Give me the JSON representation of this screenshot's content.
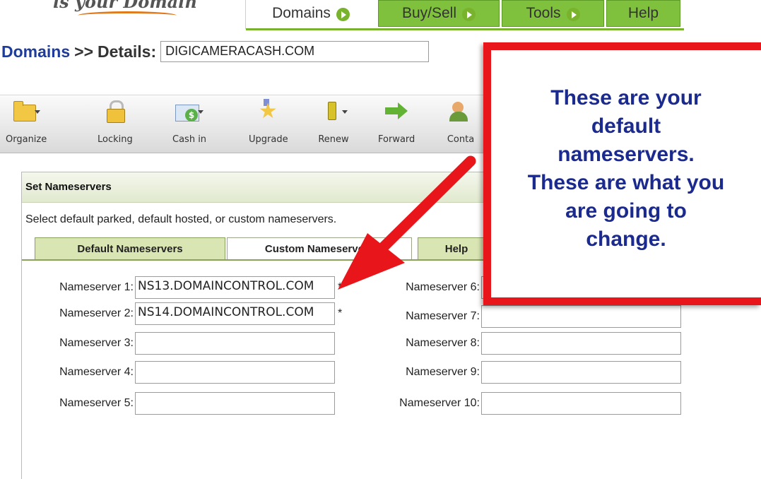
{
  "nav": {
    "logo_text": "ls your Domain",
    "tabs": [
      {
        "label": "Domains"
      },
      {
        "label": "Buy/Sell"
      },
      {
        "label": "Tools"
      },
      {
        "label": "Help"
      }
    ],
    "colors": {
      "active_tab_bg": "#ffffff",
      "tab_bg": "#7fc13c",
      "tab_icon": "#79b32d"
    }
  },
  "breadcrumb": {
    "root": "Domains",
    "separator": ">>",
    "page": "Details:",
    "domain_value": "DIGICAMERACASH.COM"
  },
  "toolbar": {
    "items": [
      {
        "label": "Organize",
        "icon": "folder-icon"
      },
      {
        "label": "Locking",
        "icon": "lock-icon"
      },
      {
        "label": "Cash in",
        "icon": "cash-icon"
      },
      {
        "label": "Upgrade",
        "icon": "star-icon"
      },
      {
        "label": "Renew",
        "icon": "renew-icon"
      },
      {
        "label": "Forward",
        "icon": "forward-arrow-icon"
      },
      {
        "label": "Conta",
        "icon": "contact-icon"
      }
    ]
  },
  "nameservers": {
    "title": "Set Nameservers",
    "description": "Select default parked, default hosted, or custom nameservers.",
    "tabs": [
      {
        "label": "Default Nameservers"
      },
      {
        "label": "Custom Nameservers"
      },
      {
        "label": "Help"
      }
    ],
    "fields": [
      {
        "label": "Nameserver 1:",
        "value": "NS13.DOMAINCONTROL.COM",
        "required": "*"
      },
      {
        "label": "Nameserver 2:",
        "value": "NS14.DOMAINCONTROL.COM",
        "required": "*"
      },
      {
        "label": "Nameserver 3:",
        "value": ""
      },
      {
        "label": "Nameserver 4:",
        "value": ""
      },
      {
        "label": "Nameserver 5:",
        "value": ""
      },
      {
        "label": "Nameserver 6:",
        "value": ""
      },
      {
        "label": "Nameserver 7:",
        "value": ""
      },
      {
        "label": "Nameserver 8:",
        "value": ""
      },
      {
        "label": "Nameserver 9:",
        "value": ""
      },
      {
        "label": "Nameserver 10:",
        "value": ""
      }
    ],
    "colors": {
      "header_bg": "#e1e9cf",
      "tab_bg": "#d9e6b3"
    }
  },
  "callout": {
    "lines": [
      "These are your",
      "default",
      "nameservers.",
      "These are what you",
      "are going to",
      "change."
    ],
    "colors": {
      "border": "#e8161a",
      "text": "#1b2a8f",
      "arrow": "#e8161a"
    }
  }
}
